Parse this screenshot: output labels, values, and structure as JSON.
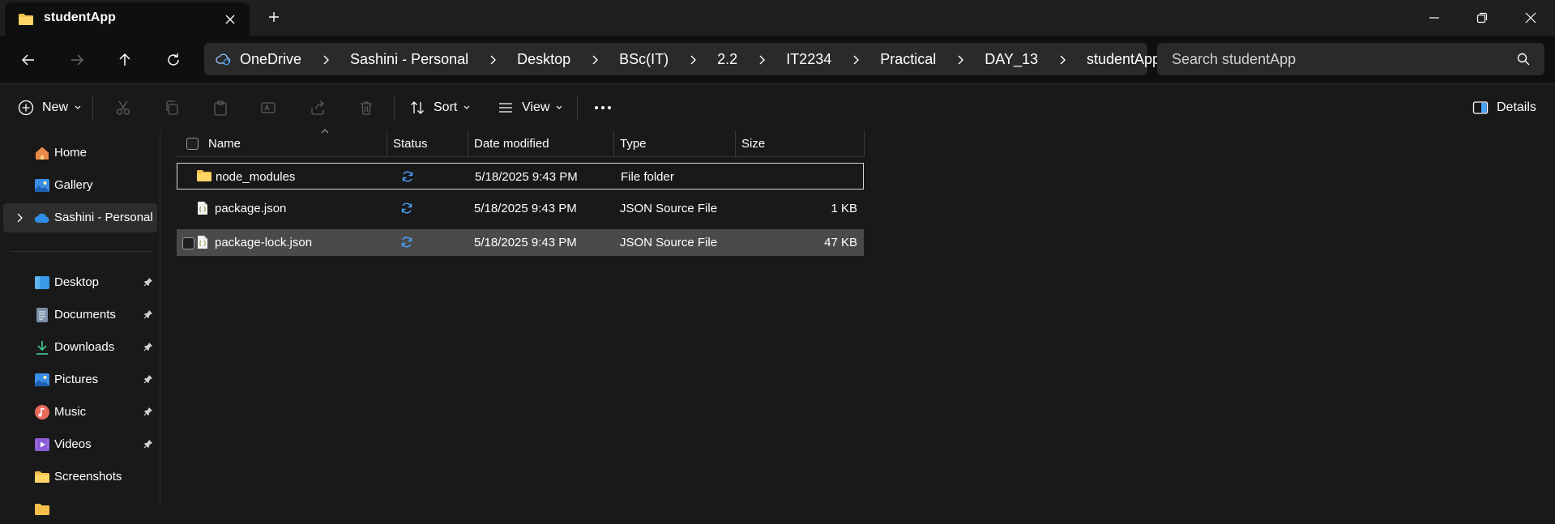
{
  "window": {
    "tab_title": "studentApp"
  },
  "address": {
    "breadcrumbs": [
      "OneDrive",
      "Sashini - Personal",
      "Desktop",
      "BSc(IT)",
      "2.2",
      "IT2234",
      "Practical",
      "DAY_13",
      "studentApp"
    ]
  },
  "search": {
    "placeholder": "Search studentApp"
  },
  "toolbar": {
    "new_label": "New",
    "sort_label": "Sort",
    "view_label": "View",
    "details_label": "Details"
  },
  "sidebar": {
    "top_items": [
      {
        "label": "Home",
        "icon": "home-icon"
      },
      {
        "label": "Gallery",
        "icon": "gallery-icon"
      },
      {
        "label": "Sashini - Personal",
        "icon": "onedrive-cloud-icon"
      }
    ],
    "quick_access": [
      {
        "label": "Desktop",
        "icon": "desktop-folder-icon",
        "pinned": true
      },
      {
        "label": "Documents",
        "icon": "documents-folder-icon",
        "pinned": true
      },
      {
        "label": "Downloads",
        "icon": "downloads-folder-icon",
        "pinned": true
      },
      {
        "label": "Pictures",
        "icon": "pictures-folder-icon",
        "pinned": true
      },
      {
        "label": "Music",
        "icon": "music-folder-icon",
        "pinned": true
      },
      {
        "label": "Videos",
        "icon": "videos-folder-icon",
        "pinned": true
      },
      {
        "label": "Screenshots",
        "icon": "folder-icon",
        "pinned": false
      }
    ]
  },
  "file_list": {
    "columns": [
      "Name",
      "Status",
      "Date modified",
      "Type",
      "Size"
    ],
    "rows": [
      {
        "name": "node_modules",
        "icon": "folder-icon",
        "status": "sync-pending-icon",
        "date": "5/18/2025 9:43 PM",
        "type": "File folder",
        "size": ""
      },
      {
        "name": "package.json",
        "icon": "json-file-icon",
        "status": "sync-pending-icon",
        "date": "5/18/2025 9:43 PM",
        "type": "JSON Source File",
        "size": "1 KB"
      },
      {
        "name": "package-lock.json",
        "icon": "json-file-icon",
        "status": "sync-pending-icon",
        "date": "5/18/2025 9:43 PM",
        "type": "JSON Source File",
        "size": "47 KB"
      }
    ]
  },
  "colors": {
    "folder": "#f5c04a",
    "sync": "#4aa3ff",
    "background": "#191919"
  }
}
